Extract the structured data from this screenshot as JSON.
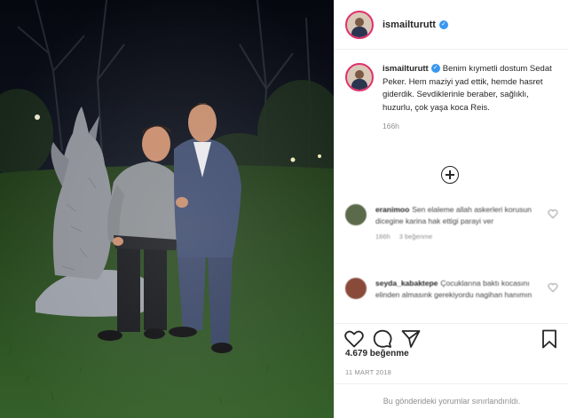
{
  "post": {
    "username": "ismailturutt",
    "caption": "Benim kıymetli dostum Sedat Peker. Hem maziyi yad ettik, hemde hasret giderdik. Sevdiklerinle beraber, sağlıklı, huzurlu, çok yaşa koca Reis.",
    "caption_time": "166h",
    "likes": "4.679 beğenme",
    "date": "11 MART 2018",
    "comments_disabled": "Bu gönderideki yorumlar sınırlandırıldı."
  },
  "comments": [
    {
      "username": "eranimoo",
      "text": "Sen elaleme allah askerleri korusun dicegine karina hak ettigi parayi ver",
      "time": "166h",
      "likes": "3 beğenme"
    },
    {
      "username": "seyda_kabaktepe",
      "text": "Çocuklarına baktı kocasını elinden almasınk gerekiyordu nagihan hanımın",
      "time": "",
      "likes": ""
    }
  ],
  "icons": {
    "verified": "verified-badge-icon",
    "like": "heart-icon",
    "comment": "comment-bubble-icon",
    "share": "paper-plane-icon",
    "save": "bookmark-icon",
    "load_more": "plus-circle-icon"
  },
  "colors": {
    "verified": "#3897f0",
    "story_ring": "#e1306c",
    "muted_text": "#8e8e8e"
  }
}
